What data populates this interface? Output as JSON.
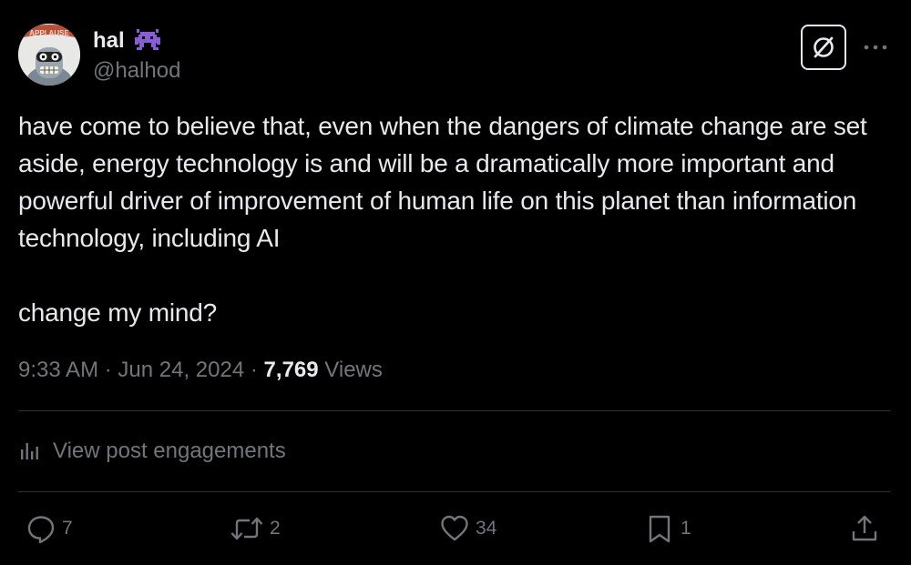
{
  "author": {
    "display_name": "hal",
    "handle": "@halhod",
    "avatar_icon": "bender-avatar-icon",
    "avatar_badge_text": "APPLAUSE",
    "name_emoji_icon": "alien-monster-icon"
  },
  "header": {
    "grok_icon": "grok-icon",
    "more_icon": "more-dots-icon"
  },
  "post": {
    "text": "have come to believe that, even when the dangers of climate change are set aside, energy technology is and will be a dramatically more important and powerful driver of improvement of human life on this planet than information technology, including AI\n\nchange my mind?",
    "time": "9:33 AM",
    "separator": "·",
    "date": "Jun 24, 2024",
    "views_count": "7,769",
    "views_label": "Views"
  },
  "engagements": {
    "label": "View post engagements",
    "icon": "analytics-icon"
  },
  "actions": {
    "reply": {
      "icon": "reply-icon",
      "count": "7"
    },
    "repost": {
      "icon": "repost-icon",
      "count": "2"
    },
    "like": {
      "icon": "heart-icon",
      "count": "34"
    },
    "bookmark": {
      "icon": "bookmark-icon",
      "count": "1"
    },
    "share": {
      "icon": "share-icon"
    }
  },
  "colors": {
    "background": "#000000",
    "primary_text": "#e7e9ea",
    "secondary_text": "#71767b",
    "divider": "#2f3336",
    "emoji_purple": "#8a5cd6"
  }
}
